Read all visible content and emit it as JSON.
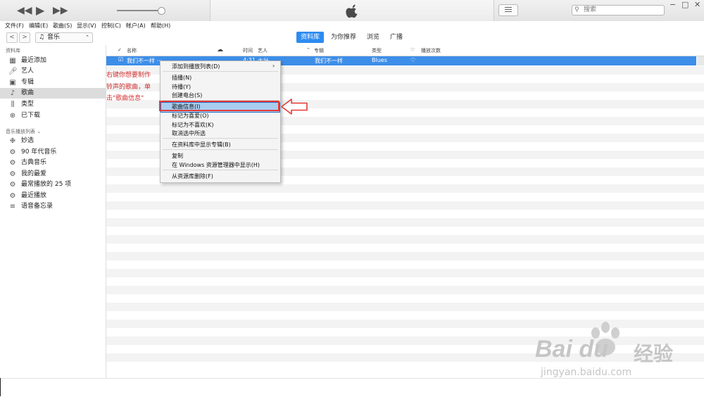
{
  "titlebar": {
    "rewind_icon": "rewind-icon",
    "play_icon": "play-icon",
    "forward_icon": "fast-forward-icon",
    "logo_icon": "apple-logo-icon",
    "search_placeholder": "搜索",
    "win_min": "−",
    "win_max": "□",
    "win_close": "✕"
  },
  "menubar": [
    "文件(F)",
    "编辑(E)",
    "歌曲(S)",
    "显示(V)",
    "控制(C)",
    "帐户(A)",
    "帮助(H)"
  ],
  "nav": {
    "back": "<",
    "forward": ">",
    "media_label": "音乐",
    "tabs": [
      "资料库",
      "为你推荐",
      "浏览",
      "广播"
    ]
  },
  "sidebar": {
    "library_header": "资料库",
    "library_items": [
      "最近添加",
      "艺人",
      "专辑",
      "歌曲",
      "类型",
      "已下载"
    ],
    "playlists_header": "音乐播放列表 ⌄",
    "playlist_items": [
      "妙选",
      "90 年代音乐",
      "古典音乐",
      "我的最爱",
      "最常播放的 25 项",
      "最近播放",
      "语音备忘录"
    ]
  },
  "columns": {
    "name": "名称",
    "time": "时间",
    "artist": "艺人",
    "album": "专辑",
    "genre": "类型",
    "plays": "播放次数"
  },
  "song": {
    "name": "我们不一样 ···",
    "album": "我们不一样",
    "genre": "Blues",
    "time": "4:31",
    "artist": "大壮"
  },
  "annotation": [
    "右键你想要制作",
    "铃声的歌曲，单",
    "击\"歌曲信息\""
  ],
  "context_menu": [
    "添加到播放列表(D)",
    "插播(N)",
    "待播(Y)",
    "创建电台(S)",
    "歌曲信息(I)",
    "标记为喜爱(O)",
    "标记为不喜欢(K)",
    "取消选中所选",
    "在资料库中显示专辑(B)",
    "复制",
    "在 Windows 资源管理器中显示(H)",
    "从资源库删除(F)"
  ],
  "watermark": {
    "brand": "Bai du",
    "cn": "经验",
    "url": "jingyan.baidu.com"
  },
  "colors": {
    "accent": "#2d8cf0",
    "selection": "#3d8ee8",
    "annotation_red": "#d32f2f"
  }
}
